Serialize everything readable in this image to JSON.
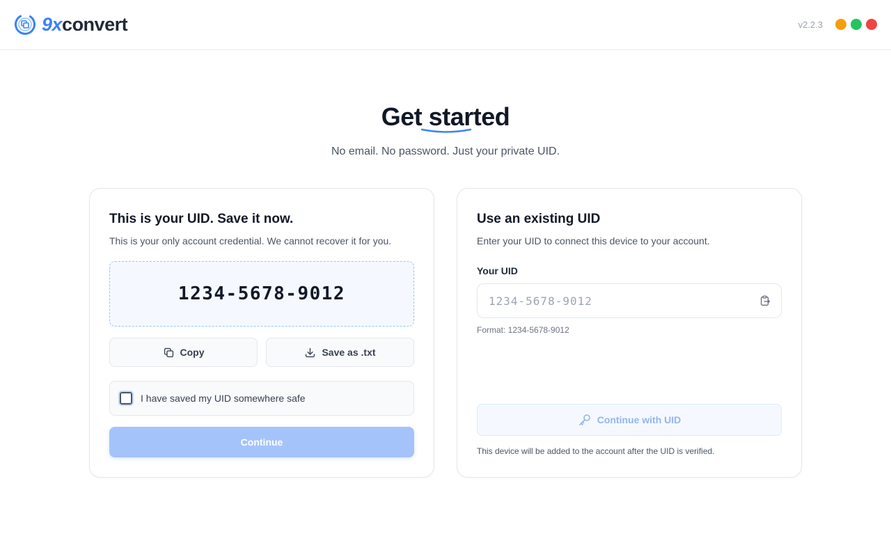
{
  "app": {
    "logo_accent": "9x",
    "logo_rest": "convert",
    "version": "v2.2.3",
    "brand_color": "#3b82f6",
    "window_controls": [
      {
        "name": "minimize",
        "color": "#f59e0b"
      },
      {
        "name": "maximize",
        "color": "#22c55e"
      },
      {
        "name": "close",
        "color": "#ef4444"
      }
    ]
  },
  "hero": {
    "title": "Get started",
    "subtitle": "No email. No password. Just your private UID."
  },
  "new_uid": {
    "title": "This is your UID. Save it now.",
    "description": "This is your only account credential. We cannot recover it for you.",
    "uid": "1234-5678-9012",
    "copy_label": "Copy",
    "copy_icon": "copy-icon",
    "save_label": "Save as .txt",
    "save_icon": "download-icon",
    "confirm_label": "I have saved my UID somewhere safe",
    "confirm_checked": false,
    "continue_label": "Continue"
  },
  "existing_uid": {
    "title": "Use an existing UID",
    "description": "Enter your UID to connect this device to your account.",
    "field_label": "Your UID",
    "input_value": "",
    "input_placeholder": "1234-5678-9012",
    "paste_icon": "paste-icon",
    "format_hint": "Format: 1234-5678-9012",
    "continue_label": "Continue with UID",
    "continue_icon": "key-icon",
    "footnote": "This device will be added to the account after the UID is verified."
  }
}
